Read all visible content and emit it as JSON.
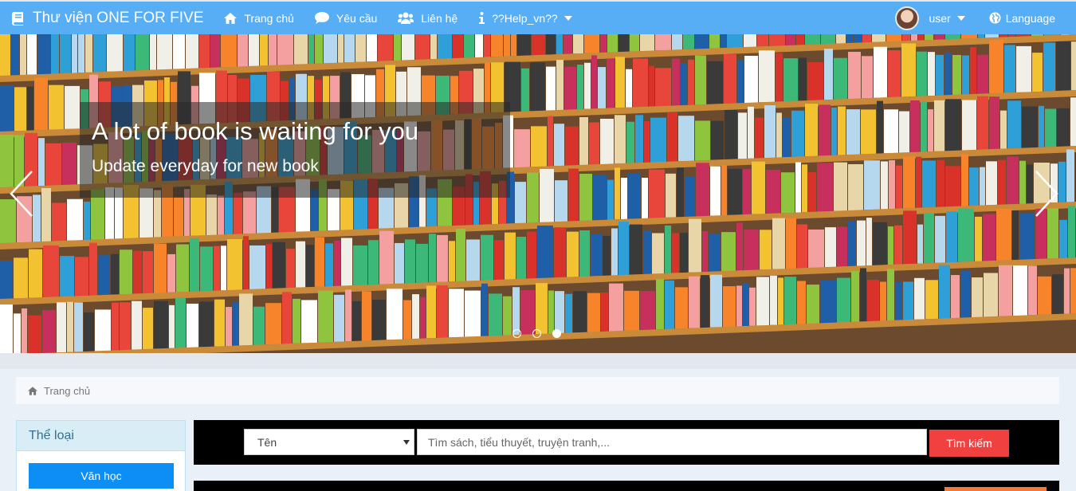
{
  "nav": {
    "brand": "Thư viện ONE FOR FIVE",
    "items": [
      {
        "label": "Trang chủ",
        "icon": "home-icon"
      },
      {
        "label": "Yêu cầu",
        "icon": "comment-icon"
      },
      {
        "label": "Liên hệ",
        "icon": "users-icon"
      },
      {
        "label": "??Help_vn??",
        "icon": "info-icon"
      }
    ],
    "user": "user",
    "language": "Language"
  },
  "carousel": {
    "title": "A lot of book is waiting for you",
    "subtitle": "Update everyday for new book",
    "slide_count": 3,
    "active_slide": 3
  },
  "breadcrumb": {
    "label": "Trang chủ"
  },
  "sidebar": {
    "heading": "Thể loại",
    "categories": [
      "Văn học"
    ]
  },
  "search": {
    "field_selected": "Tên",
    "placeholder": "Tìm sách, tiểu thuyết, truyện tranh,...",
    "value": "",
    "button": "Tìm kiếm"
  },
  "colors": {
    "navbar": "#58aef5",
    "accent_button": "#f04040",
    "category_button": "#0c8ef5",
    "sidebar_heading_bg": "#d9edf7"
  }
}
